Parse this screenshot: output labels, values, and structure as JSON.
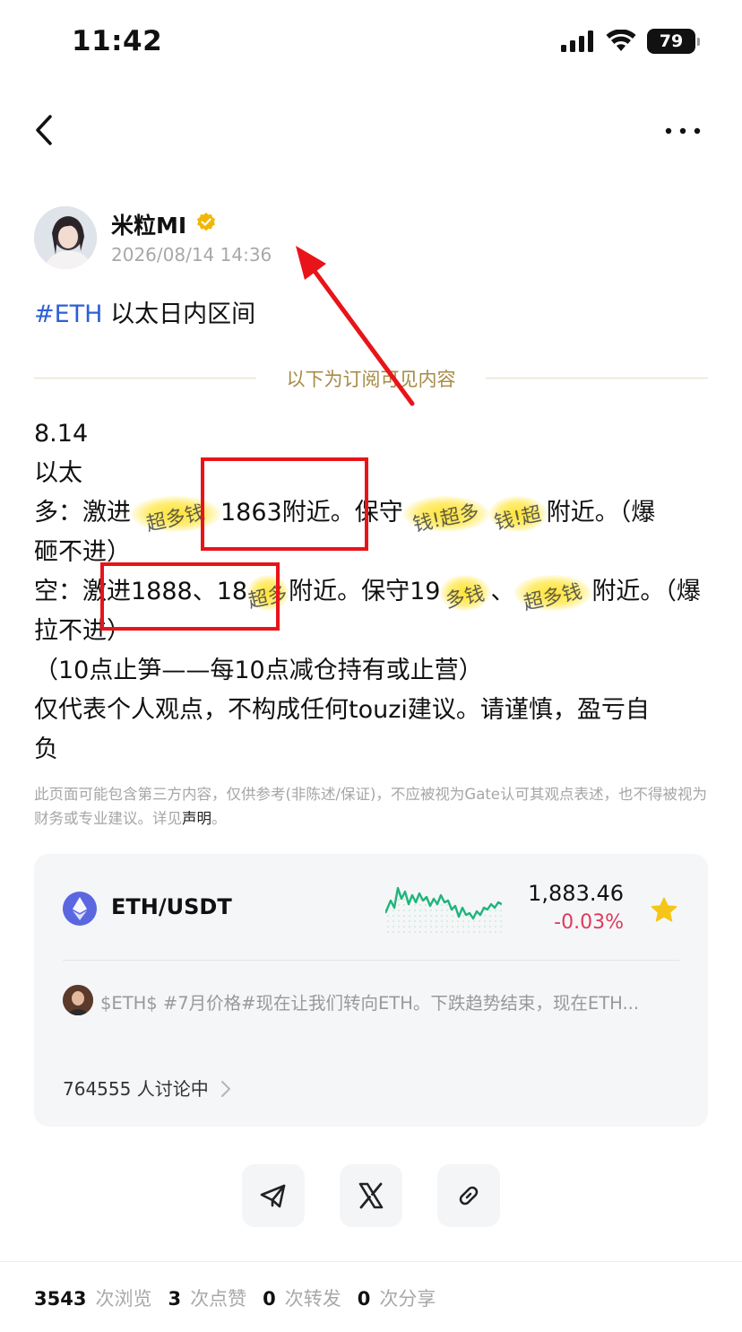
{
  "status_bar": {
    "time": "11:42",
    "battery": "79"
  },
  "author": {
    "name": "米粒MI",
    "post_time": "2026/08/14 14:36"
  },
  "post": {
    "tag": "#ETH",
    "title": " 以太日内区间",
    "subscribe_divider": "以下为订阅可见内容"
  },
  "content": {
    "date": "8.14",
    "asset": "以太",
    "long_prefix": "多：激进",
    "long_blob_1": "超多钱",
    "long_aggressive_value": "1863附近。保守",
    "long_blob_2": "钱!超多",
    "long_blob_3": "钱!超",
    "long_suffix": "附近。（爆",
    "long_line2": "砸不进）",
    "short_prefix": "空：激进1888、18",
    "short_blob_1": "超多",
    "short_mid": "附近。保守19",
    "short_blob_2": "多钱",
    "short_sep": "、",
    "short_blob_3": "超多钱",
    "short_suffix": "附近。（爆",
    "short_line2": "拉不进）",
    "stop_note": "（10点止笋——每10点减仓持有或止营）",
    "disclaimer_line1": "仅代表个人观点，不构成任何touzi建议。请谨慎，盈亏自",
    "disclaimer_line2": "负"
  },
  "legal": {
    "text": "此页面可能包含第三方内容，仅供参考(非陈述/保证)，不应被视为Gate认可其观点表述，也不得被视为财务或专业建议。详见",
    "link": "声明",
    "end": "。"
  },
  "market_card": {
    "pair": "ETH/USDT",
    "price": "1,883.46",
    "change": "-0.03%",
    "feed_text": "$ETH$ #7月价格#现在让我们转向ETH。下跌趋势结束，现在ETH...",
    "discussion": "764555 人讨论中",
    "colors": {
      "up": "#1fb57a",
      "down": "#e03a5a",
      "star": "#f5c518"
    }
  },
  "stats": {
    "views": "3543",
    "views_label": "次浏览",
    "likes": "3",
    "likes_label": "次点赞",
    "reposts": "0",
    "reposts_label": "次转发",
    "shares": "0",
    "shares_label": "次分享"
  },
  "icons": [
    "signal-icon",
    "wifi-icon",
    "battery-icon",
    "back-icon",
    "more-icon",
    "verified-icon",
    "eth-icon",
    "star-icon",
    "chevron-right-icon",
    "telegram-icon",
    "x-icon",
    "link-icon"
  ]
}
